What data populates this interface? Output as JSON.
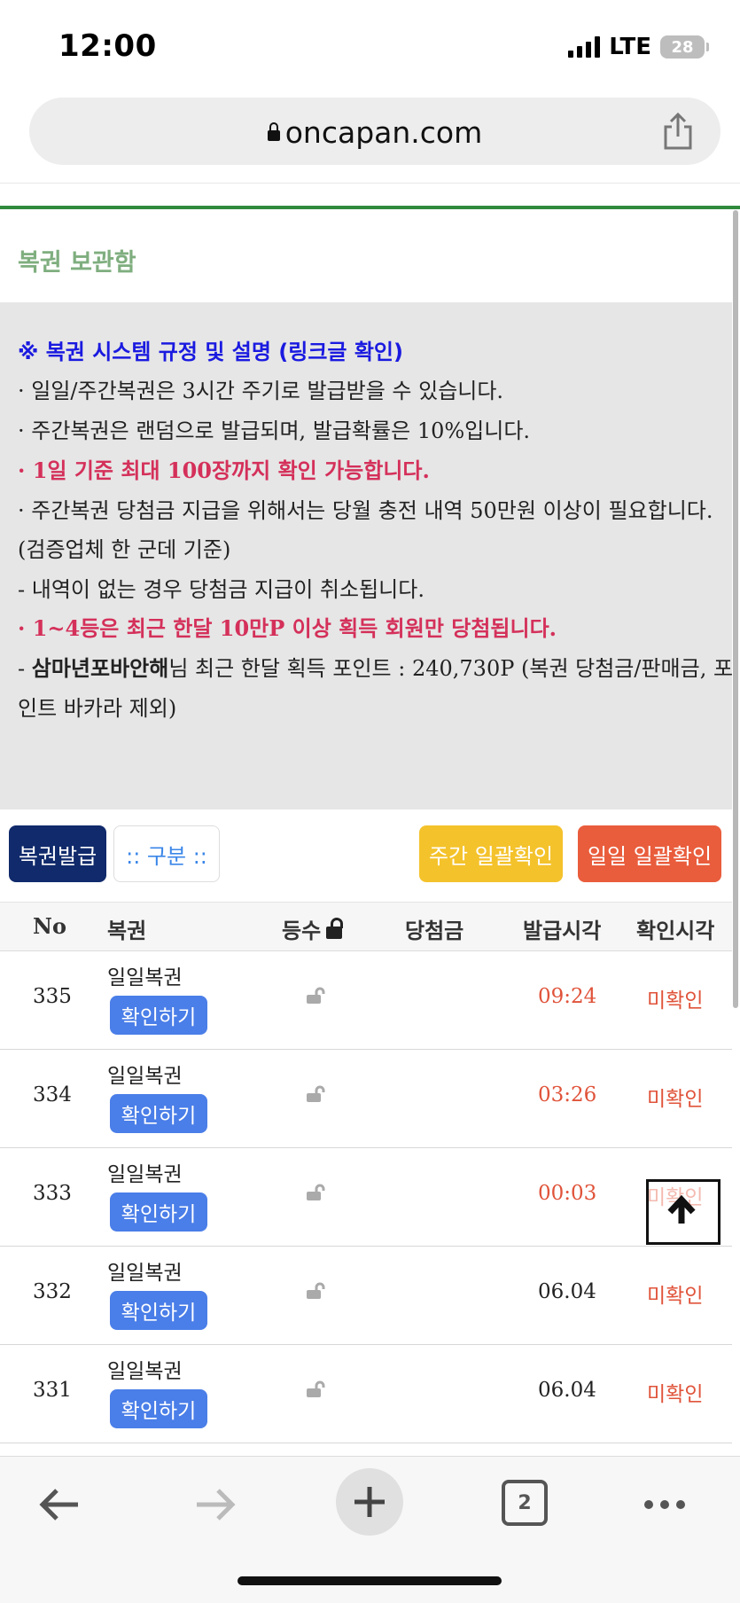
{
  "status_bar": {
    "time": "12:00",
    "network": "LTE",
    "battery": "28"
  },
  "browser": {
    "url": "oncapan.com",
    "tab_count": "2"
  },
  "page": {
    "title": "복권 보관함",
    "notice": {
      "heading": "※ 복권 시스템 규정 및 설명 (링크글 확인)",
      "lines": [
        "· 일일/주간복권은 3시간 주기로 발급받을 수 있습니다.",
        "· 주간복권은 랜덤으로 발급되며, 발급확률은 10%입니다.",
        "· 1일 기준 최대 100장까지 확인 가능합니다.",
        "· 주간복권 당첨금 지급을 위해서는 당월 충전 내역 50만원 이상이 필요합니다.",
        "(검증업체 한 군데 기준)",
        " - 내역이 없는 경우 당첨금 지급이 취소됩니다.",
        "· 1~4등은 최근 한달 10만P 이상 획득 회원만 당첨됩니다.",
        " - ",
        "삼마년포바안해",
        "님 최근 한달 획득 포인트 : 240,730P (복권 당첨금/판매금, 포",
        "인트 바카라 제외)"
      ]
    },
    "buttons": {
      "issue": "복권발급",
      "sort": ":: 구분 ::",
      "weekly_confirm": "주간 일괄확인",
      "daily_confirm": "일일 일괄확인"
    },
    "table": {
      "headers": [
        "No",
        "복권",
        "등수",
        "당첨금",
        "발급시각",
        "확인시각"
      ],
      "rows": [
        {
          "no": "335",
          "name": "일일복권",
          "action": "확인하기",
          "prize": "",
          "issued": "09:24",
          "checked": "미확인"
        },
        {
          "no": "334",
          "name": "일일복권",
          "action": "확인하기",
          "prize": "",
          "issued": "03:26",
          "checked": "미확인"
        },
        {
          "no": "333",
          "name": "일일복권",
          "action": "확인하기",
          "prize": "",
          "issued": "00:03",
          "checked": "미확인"
        },
        {
          "no": "332",
          "name": "일일복권",
          "action": "확인하기",
          "prize": "",
          "issued": "06.04",
          "checked": "미확인"
        },
        {
          "no": "331",
          "name": "일일복권",
          "action": "확인하기",
          "prize": "",
          "issued": "06.04",
          "checked": "미확인"
        }
      ]
    }
  },
  "colors": {
    "accent_green": "#2f8a3c",
    "issue_button": "#102a6b",
    "weekly_button": "#f4c22b",
    "daily_button": "#e95d3c",
    "confirm_button": "#4a7ee8",
    "time_today": "#e0533a",
    "status_unconfirmed": "#e0533a",
    "notice_heading": "#1a1ae0",
    "notice_red": "#d4305a"
  },
  "icons": {
    "lock": "lock-icon",
    "share": "share-icon",
    "unlock": "unlock-icon",
    "back": "arrow-left-icon",
    "forward": "arrow-right-icon",
    "new_tab": "plus-icon",
    "tabs": "tabs-icon",
    "more": "more-dots-icon",
    "scroll_top": "arrow-up-icon"
  }
}
